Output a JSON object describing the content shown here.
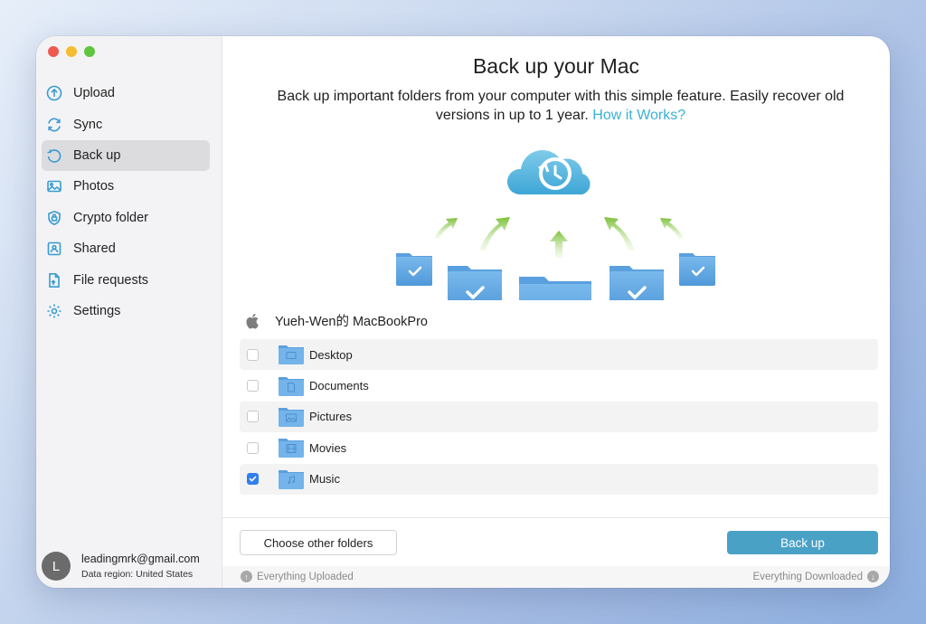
{
  "sidebar": {
    "items": [
      {
        "label": "Upload",
        "icon": "upload-icon"
      },
      {
        "label": "Sync",
        "icon": "sync-icon"
      },
      {
        "label": "Back up",
        "icon": "backup-icon",
        "active": true
      },
      {
        "label": "Photos",
        "icon": "photos-icon"
      },
      {
        "label": "Crypto folder",
        "icon": "crypto-folder-icon"
      },
      {
        "label": "Shared",
        "icon": "shared-icon"
      },
      {
        "label": "File requests",
        "icon": "file-requests-icon"
      },
      {
        "label": "Settings",
        "icon": "settings-icon"
      }
    ],
    "account": {
      "initial": "L",
      "email": "leadingmrk@gmail.com",
      "region": "Data region: United States"
    }
  },
  "main": {
    "title": "Back up your Mac",
    "subtitle": "Back up important folders from your computer with this simple feature. Easily recover old versions in up to 1 year.",
    "how_link": "How it Works?",
    "device_name": "Yueh-Wen的 MacBookPro",
    "folders": [
      {
        "label": "Desktop",
        "checked": false
      },
      {
        "label": "Documents",
        "checked": false
      },
      {
        "label": "Pictures",
        "checked": false
      },
      {
        "label": "Movies",
        "checked": false
      },
      {
        "label": "Music",
        "checked": true
      }
    ],
    "choose_button": "Choose other folders",
    "backup_button": "Back up"
  },
  "status": {
    "uploaded": "Everything Uploaded",
    "downloaded": "Everything Downloaded"
  },
  "colors": {
    "accent": "#3a9bd0",
    "link": "#3ab1d4",
    "primary_button": "#4aa1c6",
    "checkbox_checked": "#2f7ff0",
    "folder_blue": "#5aa6e0",
    "arrow_green": "#8cc63f"
  }
}
